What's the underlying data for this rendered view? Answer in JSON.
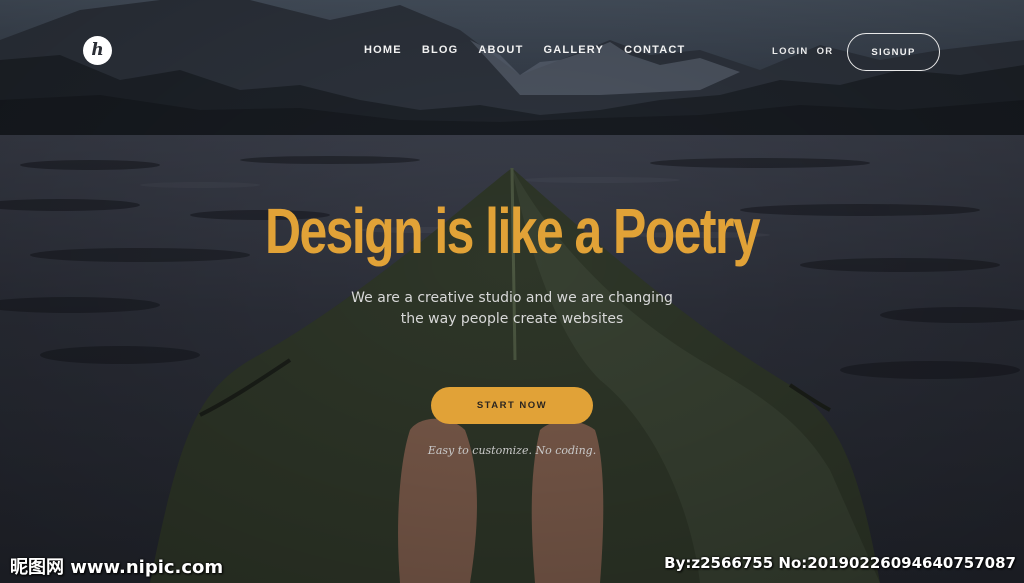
{
  "logo": {
    "letter": "h"
  },
  "nav": {
    "items": [
      {
        "label": "HOME"
      },
      {
        "label": "BLOG"
      },
      {
        "label": "ABOUT"
      },
      {
        "label": "GALLERY"
      },
      {
        "label": "CONTACT"
      }
    ],
    "login_label": "LOGIN",
    "or_label": "OR",
    "signup_label": "SIGNUP"
  },
  "hero": {
    "headline": "Design is like a Poetry",
    "subtitle_line1": "We are a  creative studio and we are changing",
    "subtitle_line2": "the way people create websites",
    "cta_label": "START NOW",
    "note": "Easy to customize. No coding."
  },
  "watermark": {
    "left": "昵图网 www.nipic.com",
    "right": "By:z2566755 No:20190226094640757087"
  },
  "colors": {
    "accent": "#e1a237",
    "text_light": "#f2f2f2",
    "background_dark": "#22252d"
  }
}
